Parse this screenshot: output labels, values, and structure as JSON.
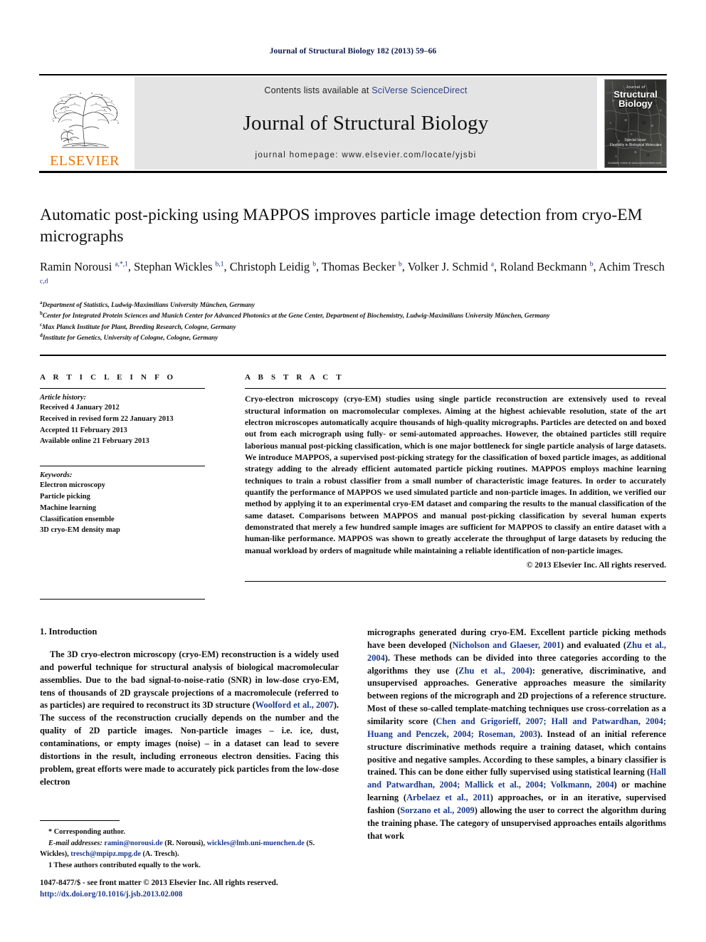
{
  "running_head": "Journal of Structural Biology 182 (2013) 59–66",
  "masthead": {
    "publisher_name": "ELSEVIER",
    "publisher_logo_icon": "elsevier-tree-icon",
    "contents_prefix": "Contents lists available at ",
    "contents_link": "SciVerse ScienceDirect",
    "journal_title": "Journal of Structural Biology",
    "homepage": "journal homepage: www.elsevier.com/locate/yjsbi",
    "cover": {
      "line1": "Journal of",
      "line2": "Structural",
      "line3": "Biology",
      "sub1": "Special Issue:",
      "sub2": "Flexibility in Biological Molecules",
      "foot": "Available online at www.sciencedirect.com"
    },
    "link_color": "#2b3e87",
    "brand_color": "#E8760C"
  },
  "title": "Automatic post-picking using MAPPOS improves particle image detection from cryo-EM micrographs",
  "authors_html": "Ramin Norousi <sup>a,*,1</sup>, Stephan Wickles <sup>b,1</sup>, Christoph Leidig <sup>b</sup>, Thomas Becker <sup>b</sup>, Volker J. Schmid <sup>a</sup>, Roland Beckmann <sup>b</sup>, Achim Tresch <sup>c,d</sup>",
  "affiliations": [
    {
      "marker": "a",
      "text": "Department of Statistics, Ludwig-Maximilians University München, Germany"
    },
    {
      "marker": "b",
      "text": "Center for Integrated Protein Sciences and Munich Center for Advanced Photonics at the Gene Center, Department of Biochemistry, Ludwig-Maximilians University München, Germany"
    },
    {
      "marker": "c",
      "text": "Max Planck Institute for Plant, Breeding Research, Cologne, Germany"
    },
    {
      "marker": "d",
      "text": "Institute for Genetics, University of Cologne, Cologne, Germany"
    }
  ],
  "article_info": {
    "heading": "A R T I C L E  I N F O",
    "history_label": "Article history:",
    "history": [
      "Received 4 January 2012",
      "Received in revised form 22 January 2013",
      "Accepted 11 February 2013",
      "Available online 21 February 2013"
    ],
    "keywords_label": "Keywords:",
    "keywords": [
      "Electron microscopy",
      "Particle picking",
      "Machine learning",
      "Classification ensemble",
      "3D cryo-EM density map"
    ]
  },
  "abstract": {
    "heading": "A B S T R A C T",
    "text": "Cryo-electron microscopy (cryo-EM) studies using single particle reconstruction are extensively used to reveal structural information on macromolecular complexes. Aiming at the highest achievable resolution, state of the art electron microscopes automatically acquire thousands of high-quality micrographs. Particles are detected on and boxed out from each micrograph using fully- or semi-automated approaches. However, the obtained particles still require laborious manual post-picking classification, which is one major bottleneck for single particle analysis of large datasets. We introduce MAPPOS, a supervised post-picking strategy for the classification of boxed particle images, as additional strategy adding to the already efficient automated particle picking routines. MAPPOS employs machine learning techniques to train a robust classifier from a small number of characteristic image features. In order to accurately quantify the performance of MAPPOS we used simulated particle and non-particle images. In addition, we verified our method by applying it to an experimental cryo-EM dataset and comparing the results to the manual classification of the same dataset. Comparisons between MAPPOS and manual post-picking classification by several human experts demonstrated that merely a few hundred sample images are sufficient for MAPPOS to classify an entire dataset with a human-like performance. MAPPOS was shown to greatly accelerate the throughput of large datasets by reducing the manual workload by orders of magnitude while maintaining a reliable identification of non-particle images.",
    "copyright": "© 2013 Elsevier Inc. All rights reserved."
  },
  "section": {
    "number_title": "1. Introduction"
  },
  "body": {
    "left_paragraph_html": "The 3D cryo-electron microscopy (cryo-EM) reconstruction is a widely used and powerful technique for structural analysis of biological macromolecular assemblies. Due to the bad signal-to-noise-ratio (SNR) in low-dose cryo-EM, tens of thousands of 2D grayscale projections of a macromolecule (referred to as particles) are required to reconstruct its 3D structure (<span class=\"ref\">Woolford et al., 2007</span>). The success of the reconstruction crucially depends on the number and the quality of 2D particle images. Non-particle images – i.e. ice, dust, contaminations, or empty images (noise) – in a dataset can lead to severe distortions in the result, including erroneous electron densities. Facing this problem, great efforts were made to accurately pick particles from the low-dose electron",
    "right_paragraph_html": "micrographs generated during cryo-EM. Excellent particle picking methods have been developed (<span class=\"ref\">Nicholson and Glaeser, 2001</span>) and evaluated (<span class=\"ref\">Zhu et al., 2004</span>). These methods can be divided into three categories according to the algorithms they use (<span class=\"ref\">Zhu et al., 2004</span>): generative, discriminative, and unsupervised approaches. Generative approaches measure the similarity between regions of the micrograph and 2D projections of a reference structure. Most of these so-called template-matching techniques use cross-correlation as a similarity score (<span class=\"ref\">Chen and Grigorieff, 2007; Hall and Patwardhan, 2004; Huang and Penczek, 2004; Roseman, 2003</span>). Instead of an initial reference structure discriminative methods require a training dataset, which contains positive and negative samples. According to these samples, a binary classifier is trained. This can be done either fully supervised using statistical learning (<span class=\"ref\">Hall and Patwardhan, 2004; Mallick et al., 2004; Volkmann, 2004</span>) or machine learning (<span class=\"ref\">Arbelaez et al., 2011</span>) approaches, or in an iterative, supervised fashion (<span class=\"ref\">Sorzano et al., 2009</span>) allowing the user to correct the algorithm during the training phase. The category of unsupervised approaches entails algorithms that work"
  },
  "footnotes": {
    "corresponding": "* Corresponding author.",
    "email_html": "<span class=\"mail-label\">E-mail addresses:</span> <span class=\"mail\">ramin@norousi.de</span> (R. Norousi), <span class=\"mail\">wickles@lmb.uni-muenchen.de</span> (S. Wickles), <span class=\"mail\">tresch@mpipz.mpg.de</span> (A. Tresch).",
    "equal_contrib": "1  These authors contributed equally to the work."
  },
  "page_footer": {
    "line1": "1047-8477/$ - see front matter © 2013 Elsevier Inc. All rights reserved.",
    "line2": "http://dx.doi.org/10.1016/j.jsb.2013.02.008"
  }
}
